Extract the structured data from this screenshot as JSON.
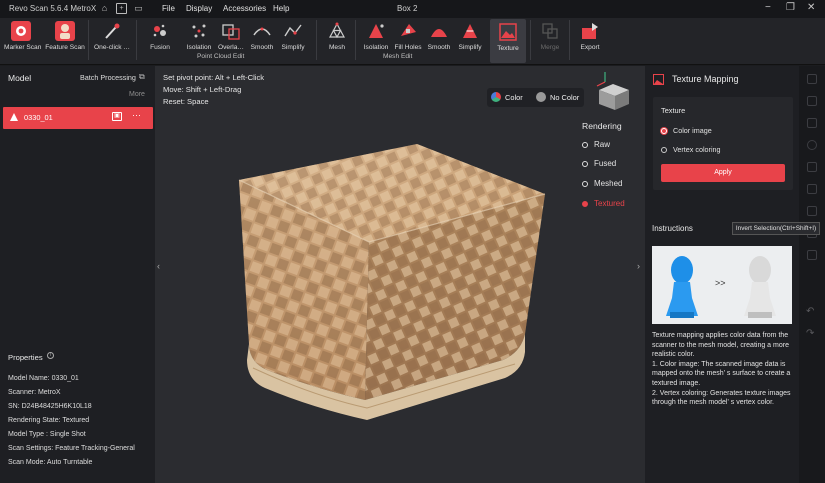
{
  "titlebar": {
    "app_title": "Revo Scan 5.6.4 MetroX",
    "menus": [
      "File",
      "Display",
      "Accessories",
      "Help"
    ],
    "document": "Box 2"
  },
  "toolbar": {
    "tools": [
      {
        "label": "Marker Scan",
        "icon": "marker-scan-icon"
      },
      {
        "label": "Feature Scan",
        "icon": "feature-scan-icon"
      },
      {
        "label": "One-click …",
        "icon": "one-click-wand-icon"
      },
      {
        "label": "Fusion",
        "icon": "fusion-icon"
      },
      {
        "label": "Isolation",
        "icon": "isolation-icon"
      },
      {
        "label": "Overla…",
        "icon": "overlap-icon"
      },
      {
        "label": "Smooth",
        "icon": "smooth-icon"
      },
      {
        "label": "Simplify",
        "icon": "simplify-icon"
      },
      {
        "label": "Mesh",
        "icon": "mesh-icon"
      },
      {
        "label": "Isolation",
        "icon": "mesh-isolation-icon"
      },
      {
        "label": "Fill Holes",
        "icon": "fill-holes-icon"
      },
      {
        "label": "Smooth",
        "icon": "mesh-smooth-icon"
      },
      {
        "label": "Simplify",
        "icon": "mesh-simplify-icon"
      },
      {
        "label": "Texture",
        "icon": "texture-icon"
      },
      {
        "label": "Merge",
        "icon": "merge-icon"
      },
      {
        "label": "Export",
        "icon": "export-icon"
      }
    ],
    "groups": [
      "Point Cloud Edit",
      "Mesh Edit"
    ]
  },
  "left": {
    "title": "Model",
    "batch": "Batch Processing",
    "more": "More",
    "model_name": "0330_01",
    "properties_title": "Properties",
    "properties": [
      "Model Name:  0330_01",
      "Scanner:  MetroX",
      "SN:  D24B48425H6K10L18",
      "Rendering State:  Textured",
      "Model Type :  Single Shot",
      "Scan Settings:  Feature Tracking-General",
      "Scan Mode:  Auto Turntable"
    ]
  },
  "viewport": {
    "hints": [
      "Set pivot point: Alt + Left-Click",
      "Move: Shift + Left-Drag",
      "Reset: Space"
    ],
    "color_label": "Color",
    "nocolor_label": "No Color",
    "rendering_title": "Rendering",
    "rendering_options": [
      "Raw",
      "Fused",
      "Meshed",
      "Textured"
    ],
    "rendering_selected": "Textured"
  },
  "right": {
    "title": "Texture Mapping",
    "section": "Texture",
    "options": [
      "Color image",
      "Vertex coloring"
    ],
    "apply": "Apply",
    "instructions_title": "Instructions",
    "tooltip": "Invert Selection(Ctrl+Shift+I)",
    "instructions": "Texture mapping applies color data from the scanner to the mesh model, creating a more realistic color.\n1. Color image: The scanned image data is mapped onto the mesh' s surface to create a textured image.\n2. Vertex coloring: Generates texture images through the mesh model' s vertex color.",
    "compare_arrow": ">>"
  },
  "colors": {
    "accent": "#e8434a",
    "panel": "#1e1f23",
    "viewport": "#2b2c30"
  }
}
